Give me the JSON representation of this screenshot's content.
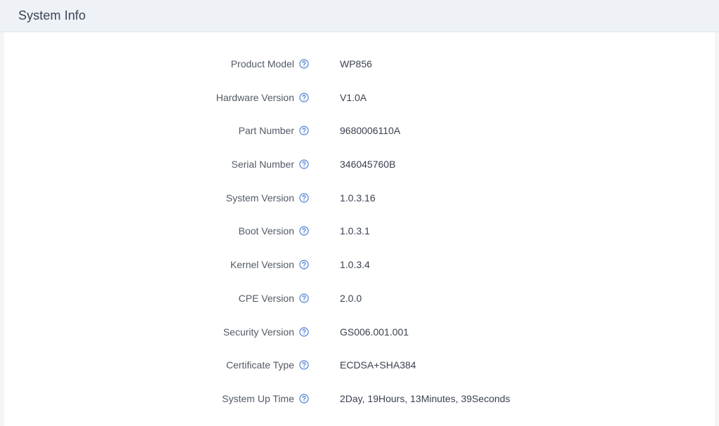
{
  "header": {
    "title": "System Info"
  },
  "colors": {
    "help_icon": "#4a7fd0",
    "header_bg": "#eef2f7",
    "panel_bg": "#ffffff"
  },
  "fields": [
    {
      "label": "Product Model",
      "value": "WP856",
      "icon": "help-circle-icon"
    },
    {
      "label": "Hardware Version",
      "value": "V1.0A",
      "icon": "help-circle-icon"
    },
    {
      "label": "Part Number",
      "value": "9680006110A",
      "icon": "help-circle-icon"
    },
    {
      "label": "Serial Number",
      "value": "346045760B",
      "icon": "help-circle-icon"
    },
    {
      "label": "System Version",
      "value": "1.0.3.16",
      "icon": "help-circle-icon"
    },
    {
      "label": "Boot Version",
      "value": "1.0.3.1",
      "icon": "help-circle-icon"
    },
    {
      "label": "Kernel Version",
      "value": "1.0.3.4",
      "icon": "help-circle-icon"
    },
    {
      "label": "CPE Version",
      "value": "2.0.0",
      "icon": "help-circle-icon"
    },
    {
      "label": "Security Version",
      "value": "GS006.001.001",
      "icon": "help-circle-icon"
    },
    {
      "label": "Certificate Type",
      "value": "ECDSA+SHA384",
      "icon": "help-circle-icon"
    },
    {
      "label": "System Up Time",
      "value": "2Day, 19Hours, 13Minutes, 39Seconds",
      "icon": "help-circle-icon"
    }
  ]
}
